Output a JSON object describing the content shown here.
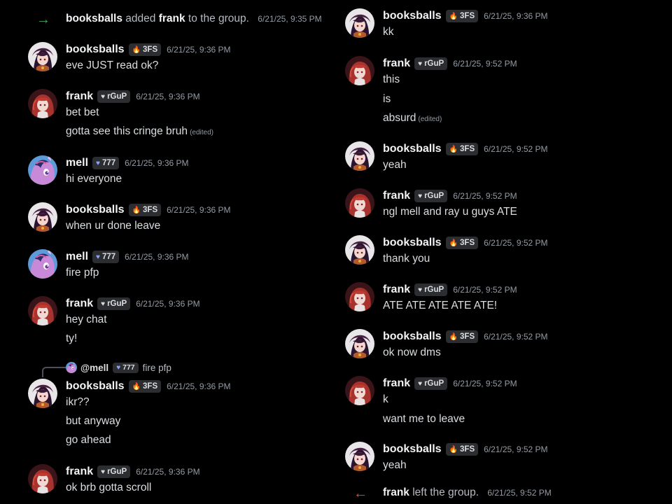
{
  "left": {
    "join_event": {
      "actor": "booksballs",
      "verb": "added",
      "target": "frank",
      "rest": "to the group.",
      "time": "6/21/25, 9:35 PM"
    },
    "messages": [
      {
        "user": "booksballs",
        "tag": "3FS",
        "time": "6/21/25, 9:36 PM",
        "lines": [
          "eve JUST read ok?"
        ]
      },
      {
        "user": "frank",
        "tag": "rGuP",
        "time": "6/21/25, 9:36 PM",
        "lines": [
          "bet bet",
          "gotta see this cringe bruh"
        ],
        "edited": "(edited)"
      },
      {
        "user": "mell",
        "tag": "777",
        "time": "6/21/25, 9:36 PM",
        "lines": [
          "hi everyone"
        ]
      },
      {
        "user": "booksballs",
        "tag": "3FS",
        "time": "6/21/25, 9:36 PM",
        "lines": [
          "when ur done leave"
        ]
      },
      {
        "user": "mell",
        "tag": "777",
        "time": "6/21/25, 9:36 PM",
        "lines": [
          "fire pfp"
        ]
      },
      {
        "user": "frank",
        "tag": "rGuP",
        "time": "6/21/25, 9:36 PM",
        "lines": [
          "hey chat",
          "ty!"
        ]
      },
      {
        "user": "booksballs",
        "tag": "3FS",
        "time": "6/21/25, 9:36 PM",
        "lines": [
          "ikr??",
          "but anyway",
          "go ahead"
        ],
        "reply": {
          "name": "@mell",
          "tag": "777",
          "text": "fire pfp"
        }
      },
      {
        "user": "frank",
        "tag": "rGuP",
        "time": "6/21/25, 9:36 PM",
        "lines": [
          "ok brb gotta scroll"
        ]
      }
    ]
  },
  "right": {
    "messages": [
      {
        "user": "booksballs",
        "tag": "3FS",
        "time": "6/21/25, 9:36 PM",
        "lines": [
          "kk"
        ]
      },
      {
        "user": "frank",
        "tag": "rGuP",
        "time": "6/21/25, 9:52 PM",
        "lines": [
          "this",
          "is",
          "absurd"
        ],
        "edited": "(edited)"
      },
      {
        "user": "booksballs",
        "tag": "3FS",
        "time": "6/21/25, 9:52 PM",
        "lines": [
          "yeah"
        ]
      },
      {
        "user": "frank",
        "tag": "rGuP",
        "time": "6/21/25, 9:52 PM",
        "lines": [
          "ngl mell and ray u guys ATE"
        ]
      },
      {
        "user": "booksballs",
        "tag": "3FS",
        "time": "6/21/25, 9:52 PM",
        "lines": [
          "thank you"
        ]
      },
      {
        "user": "frank",
        "tag": "rGuP",
        "time": "6/21/25, 9:52 PM",
        "lines": [
          "ATE ATE ATE ATE ATE!"
        ]
      },
      {
        "user": "booksballs",
        "tag": "3FS",
        "time": "6/21/25, 9:52 PM",
        "lines": [
          "ok now dms"
        ]
      },
      {
        "user": "frank",
        "tag": "rGuP",
        "time": "6/21/25, 9:52 PM",
        "lines": [
          "k",
          "want me to leave"
        ]
      },
      {
        "user": "booksballs",
        "tag": "3FS",
        "time": "6/21/25, 9:52 PM",
        "lines": [
          "yeah"
        ]
      }
    ],
    "leave_event": {
      "actor": "frank",
      "rest": "left the group.",
      "time": "6/21/25, 9:52 PM"
    }
  },
  "icons": {
    "join": "arrow-right-icon",
    "leave": "arrow-left-icon",
    "booksballs_badge": "flame-icon",
    "frank_badge": "heart-icon",
    "mell_badge": "heart-icon"
  },
  "colors": {
    "background": "#000000",
    "join_arrow": "#3ba55c",
    "leave_arrow": "#ed4245",
    "timestamp": "#949ba4",
    "flame": "#f57731",
    "frank_heart": "#dcdcdc",
    "mell_heart": "#8aa4ff"
  }
}
